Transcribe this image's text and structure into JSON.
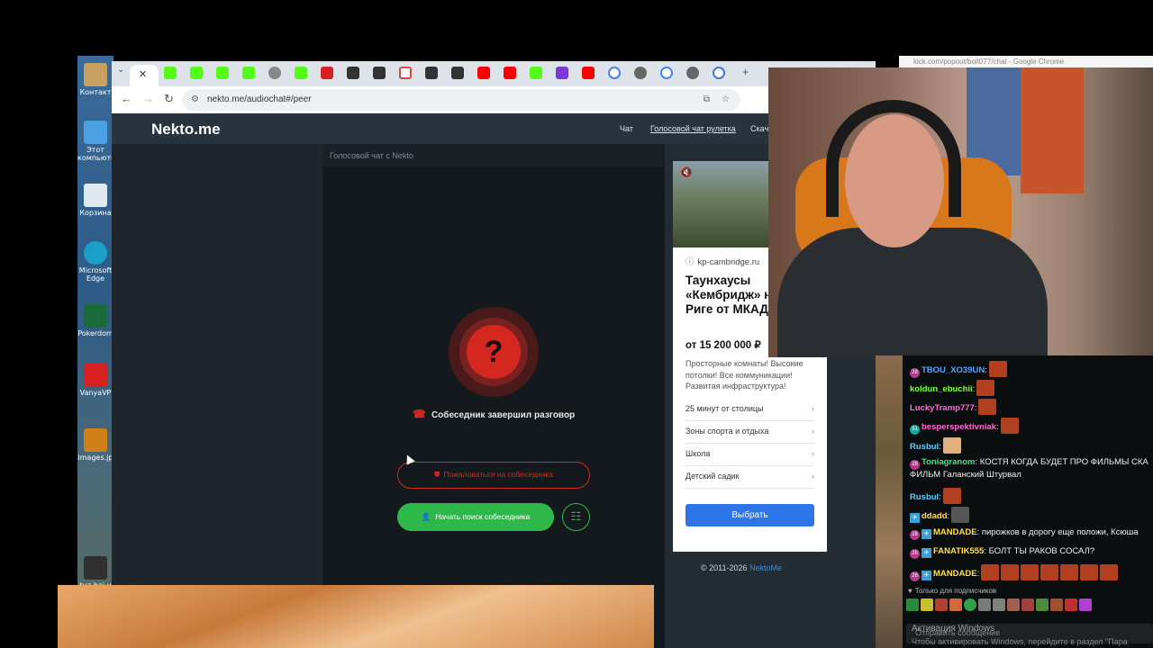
{
  "desktop": {
    "icons": [
      {
        "label": "Контакт"
      },
      {
        "label": "Этот компьютер"
      },
      {
        "label": "Корзина"
      },
      {
        "label": "Microsoft Edge"
      },
      {
        "label": "Pokerdom"
      },
      {
        "label": "VanyaVP"
      },
      {
        "label": "images.jp"
      },
      {
        "label": "tuz-hai-v"
      }
    ]
  },
  "browser": {
    "url": "nekto.me/audiochat#/peer",
    "new_tab": "+"
  },
  "site": {
    "logo": "Nekto.me",
    "nav": [
      "Чат",
      "Голосовой чат рулетка",
      "Скача"
    ],
    "chat_header": "Голосовой чат с Nekto",
    "question_mark": "?",
    "status": "Собеседник завершил разговор",
    "report_button": "Пожаловаться на собеседника",
    "search_button": "Начать поиск собеседника",
    "copyright_prefix": "© 2011-2026 ",
    "copyright_link": "NektoMe"
  },
  "ad": {
    "domain": "kp-cambridge.ru",
    "title": "Таунхаусы «Кембридж» на Новой Риге от МКАД",
    "price": "от 15 200 000 ₽",
    "description": "Просторные комнаты! Высокие потолки! Все коммуникации! Развитая инфраструктура!",
    "links": [
      "25 минут от столицы",
      "Зоны спорта и отдыха",
      "Школа",
      "Детский садик"
    ],
    "cta": "Выбрать"
  },
  "kick": {
    "window_title": "kick.com/popout/boit077/chat - Google Chrome",
    "messages": [
      {
        "user": "TBOU_XO39UN",
        "text": ":",
        "color": "#5aa0ff",
        "badge": "28"
      },
      {
        "user": "koldun_ebuchii",
        "text": ":",
        "color": "#7cff3a"
      },
      {
        "user": "LuckyTramp777",
        "text": ":",
        "color": "#ff6bd0"
      },
      {
        "user": "besperspektivniak",
        "text": ":",
        "color": "#ff6bd0",
        "badge": "31"
      },
      {
        "user": "Rusbul",
        "text": ":",
        "color": "#5ad0ff"
      },
      {
        "user": "Toniagranom",
        "text": ": КОСТЯ КОГДА БУДЕТ ПРО ФИЛЬМЫ СКА",
        "color": "#45e08a",
        "badge": "28"
      },
      {
        "user": "",
        "text": "ФИЛЬМ Галанский Штурвал",
        "color": "#efefef"
      },
      {
        "user": "Rusbul",
        "text": ":",
        "color": "#5ad0ff"
      },
      {
        "user": "ddadd",
        "text": ":",
        "color": "#ffe04a"
      },
      {
        "user": "MANDADE",
        "text": ": пирожков в дорогу еще положи, Ксюша",
        "color": "#ffe04a",
        "badge": "28"
      },
      {
        "user": "FANATIK555",
        "text": ": БОЛТ ТЫ РАКОВ СОСАЛ?",
        "color": "#ffe04a",
        "badge": "28"
      },
      {
        "user": "MANDADE",
        "text": ":",
        "color": "#ffe04a",
        "badge": "28"
      }
    ],
    "subscribers_only": "Только для подписчиков",
    "send_placeholder": "Отправить сообщение"
  },
  "windows_watermark": {
    "line1": "Активация Windows",
    "line2": "Чтобы активировать Windows, перейдите в раздел \"Пара"
  }
}
